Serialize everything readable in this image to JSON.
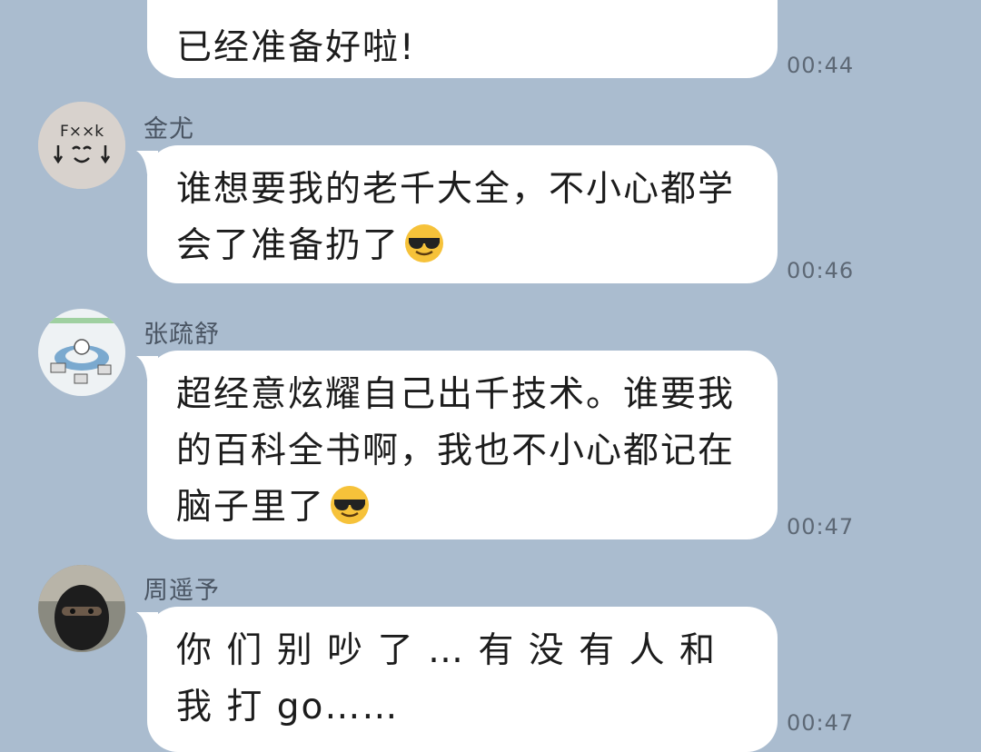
{
  "messages": [
    {
      "id": "m0",
      "sender": "",
      "text": "已经准备好啦!",
      "time": "00:44"
    },
    {
      "id": "m1",
      "sender": "金尤",
      "avatar_text": "F××k",
      "text": "谁想要我的老千大全，不小心都学会了准备扔了",
      "emoji": "sunglasses-face",
      "time": "00:46"
    },
    {
      "id": "m2",
      "sender": "张疏舒",
      "text": "超经意炫耀自己出千技术。谁要我的百科全书啊，我也不小心都记在脑子里了",
      "emoji": "sunglasses-face",
      "time": "00:47"
    },
    {
      "id": "m3",
      "sender": "周遥予",
      "text": "你 们 别 吵 了 … 有 没 有 人 和 我 打 go……",
      "time": "00:47"
    }
  ],
  "colors": {
    "background": "#aabccf",
    "bubble": "#ffffff",
    "sender": "#4a5563",
    "time": "#5d6875"
  }
}
